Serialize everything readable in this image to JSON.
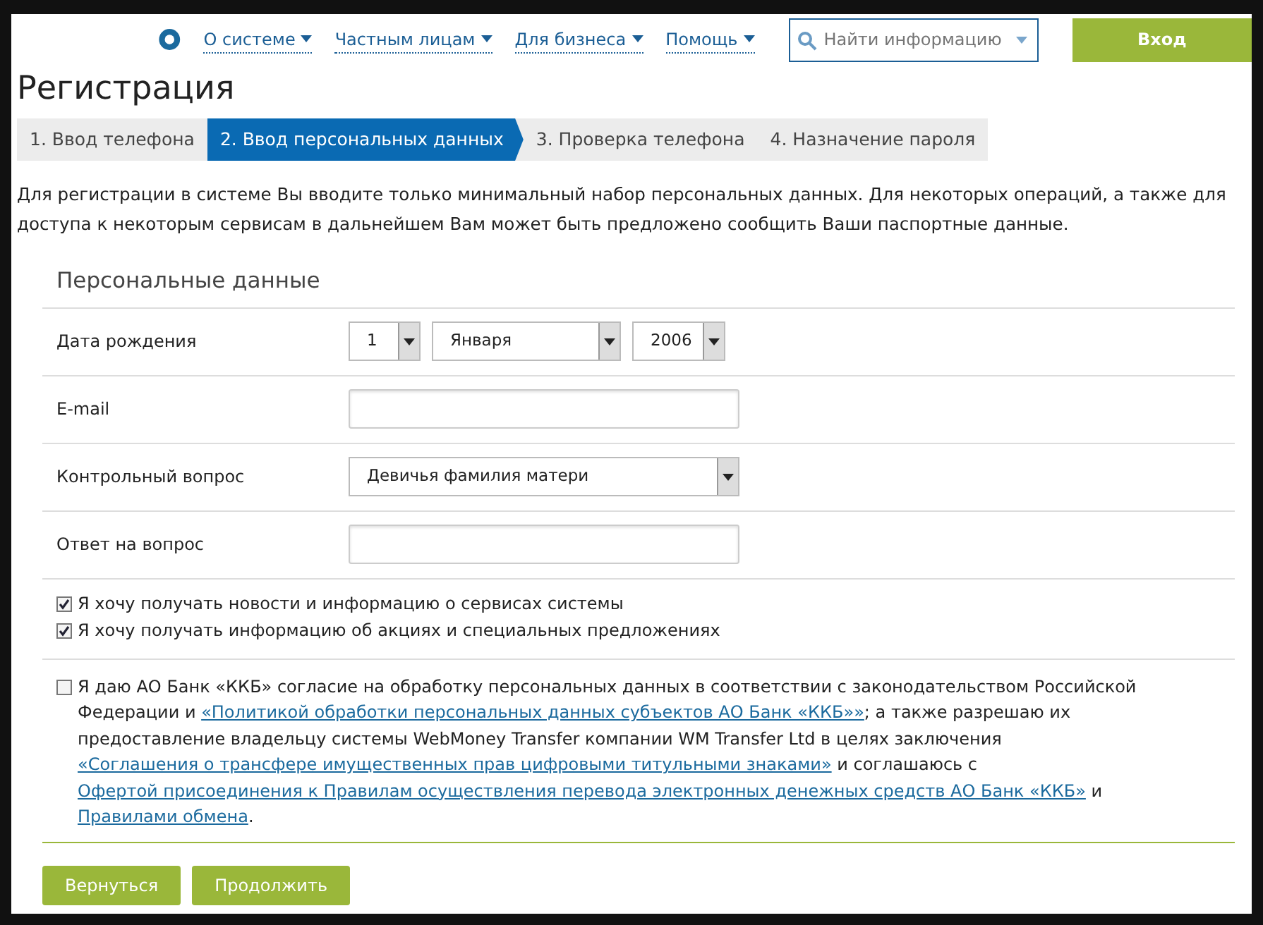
{
  "header": {
    "nav": [
      {
        "label": "О системе"
      },
      {
        "label": "Частным лицам"
      },
      {
        "label": "Для бизнеса"
      },
      {
        "label": "Помощь"
      }
    ],
    "search": {
      "placeholder": "Найти информацию"
    },
    "login_button": "Вход"
  },
  "title": "Регистрация",
  "steps": [
    {
      "label": "1. Ввод телефона",
      "selected": false
    },
    {
      "label": "2. Ввод персональных данных",
      "selected": true
    },
    {
      "label": "3. Проверка телефона",
      "selected": false
    },
    {
      "label": "4. Назначение пароля",
      "selected": false
    }
  ],
  "intro": "Для регистрации в системе Вы вводите только минимальный набор персональных данных. Для некоторых операций, а также для доступа к некоторым сервисам в дальнейшем Вам может быть предложено сообщить Ваши паспортные данные.",
  "section_title": "Персональные данные",
  "fields": [
    {
      "kind": "date",
      "label": "Дата рождения",
      "day": "1",
      "month": "Января",
      "year": "2006"
    },
    {
      "kind": "input",
      "label": "E-mail"
    },
    {
      "kind": "select",
      "label": "Контрольный вопрос",
      "value": "Девичья фамилия матери"
    },
    {
      "kind": "input",
      "label": "Ответ на вопрос"
    }
  ],
  "subscriptions": [
    {
      "label": "Я хочу получать новости и информацию о сервисах системы",
      "checked": true
    },
    {
      "label": "Я хочу получать информацию об акциях и специальных предложениях",
      "checked": true
    }
  ],
  "consent": {
    "checked": false,
    "parts": [
      {
        "kind": "text",
        "text": "Я даю АО Банк «ККБ» согласие на обработку персональных данных в соответствии с законодательством Российской Федерации и "
      },
      {
        "kind": "link",
        "text": "«Политикой обработки персональных данных субъектов АО Банк «ККБ»»"
      },
      {
        "kind": "text",
        "text": "; а также разрешаю их предоставление владельцу системы WebMoney Transfer компании WM Transfer Ltd в целях заключения "
      },
      {
        "kind": "link",
        "text": "«Соглашения о трансфере имущественных прав цифровыми титульными знаками»"
      },
      {
        "kind": "text",
        "text": " и соглашаюсь с "
      },
      {
        "kind": "link",
        "text": "Офертой присоединения к Правилам осуществления перевода электронных денежных средств АО Банк «ККБ»"
      },
      {
        "kind": "text",
        "text": " и "
      },
      {
        "kind": "link",
        "text": "Правилами обмена"
      },
      {
        "kind": "text",
        "text": "."
      }
    ]
  },
  "buttons": [
    "Вернуться",
    "Продолжить"
  ]
}
